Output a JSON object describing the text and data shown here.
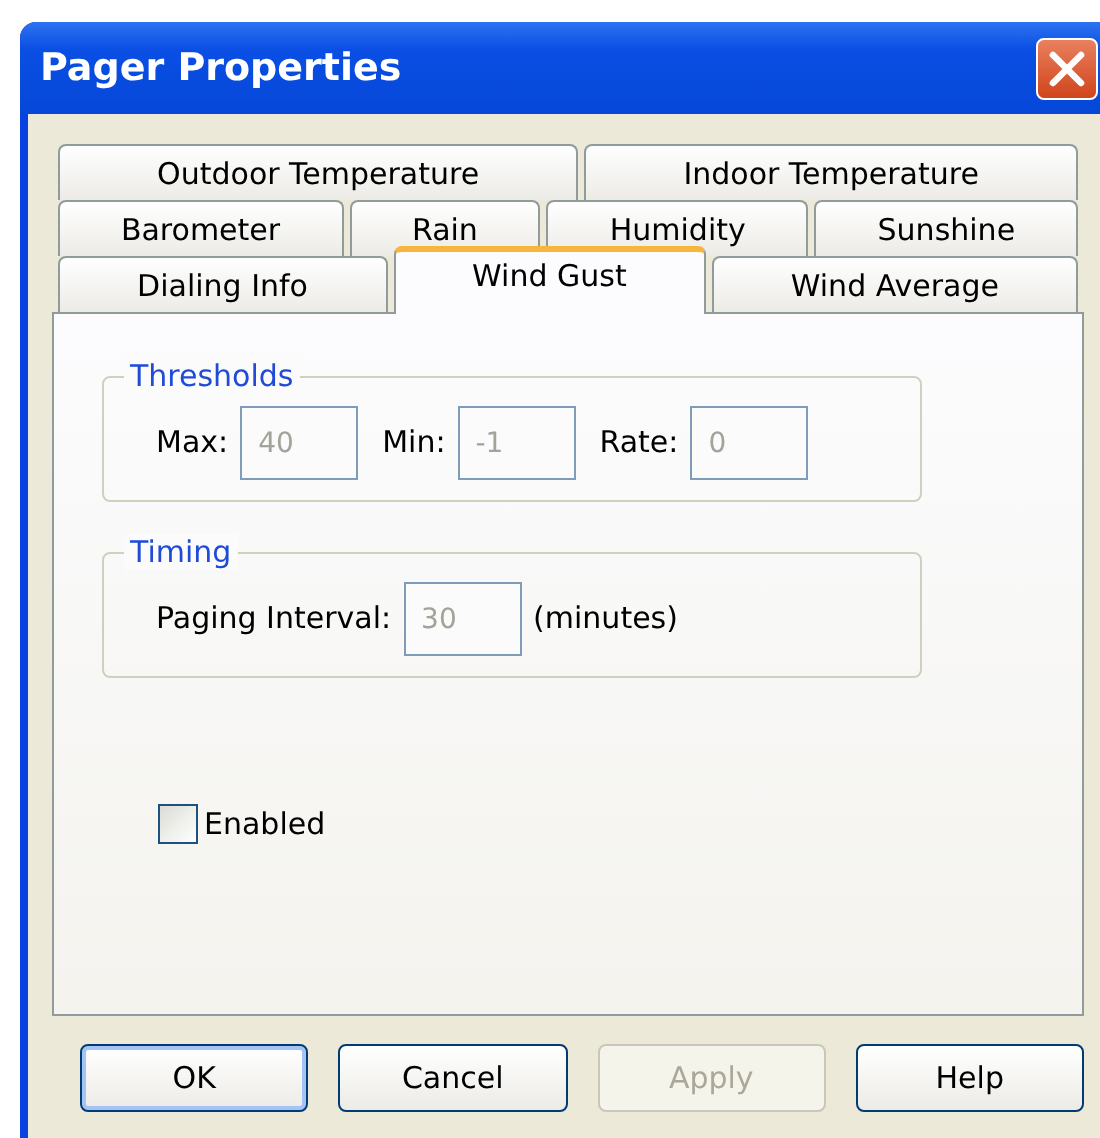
{
  "window": {
    "title": "Pager Properties"
  },
  "tab_rows": [
    [
      {
        "label": "Outdoor Temperature",
        "selected": false
      },
      {
        "label": "Indoor Temperature",
        "selected": false
      }
    ],
    [
      {
        "label": "Barometer",
        "selected": false
      },
      {
        "label": "Rain",
        "selected": false
      },
      {
        "label": "Humidity",
        "selected": false
      },
      {
        "label": "Sunshine",
        "selected": false
      }
    ],
    [
      {
        "label": "Dialing Info",
        "selected": false
      },
      {
        "label": "Wind Gust",
        "selected": true
      },
      {
        "label": "Wind Average",
        "selected": false
      }
    ]
  ],
  "groups": [
    {
      "title": "Thresholds",
      "fields": [
        {
          "label": "Max:",
          "value": "40",
          "disabled": true
        },
        {
          "label": "Min:",
          "value": "-1",
          "disabled": true
        },
        {
          "label": "Rate:",
          "value": "0",
          "disabled": true
        }
      ]
    },
    {
      "title": "Timing",
      "fields": [
        {
          "label": "Paging Interval:",
          "value": "30",
          "disabled": true,
          "unit": "(minutes)"
        }
      ]
    }
  ],
  "enabled_checkbox": {
    "label": "Enabled",
    "checked": false
  },
  "buttons": [
    {
      "label": "OK",
      "disabled": false,
      "default": true
    },
    {
      "label": "Cancel",
      "disabled": false,
      "default": false
    },
    {
      "label": "Apply",
      "disabled": true,
      "default": false
    },
    {
      "label": "Help",
      "disabled": false,
      "default": false
    }
  ]
}
